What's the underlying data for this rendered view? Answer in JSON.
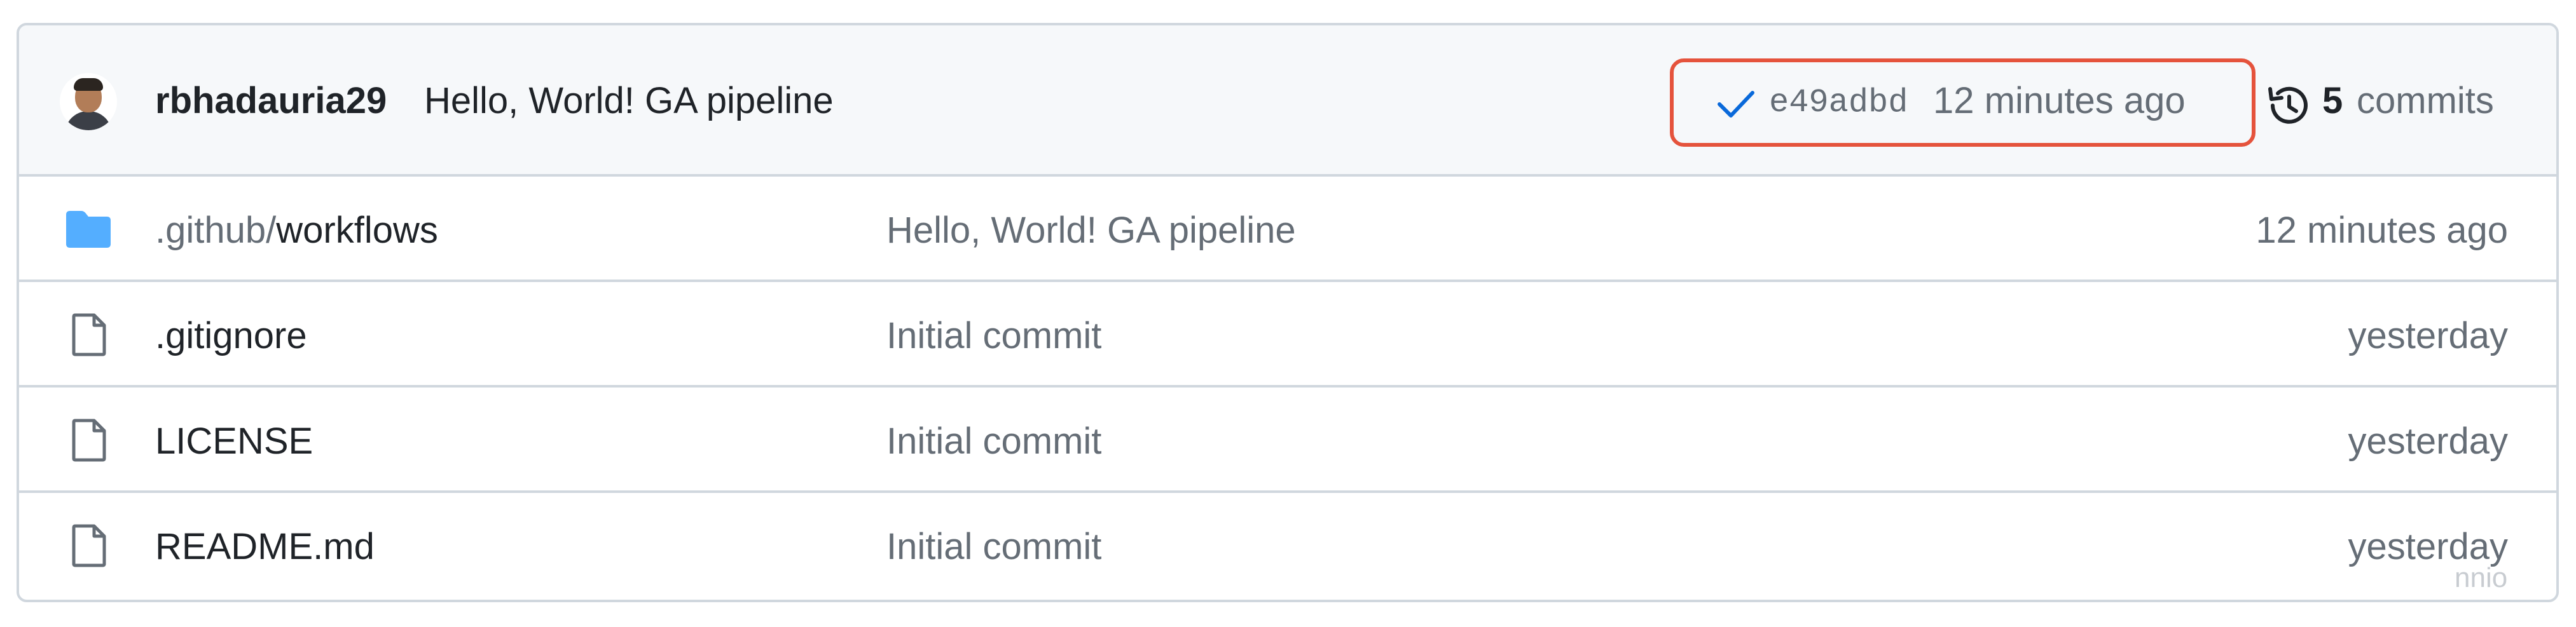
{
  "latest_commit": {
    "author": "rbhadauria29",
    "message": "Hello, World! GA pipeline",
    "status_icon": "check-icon",
    "sha": "e49adbd",
    "time": "12 minutes ago",
    "history_icon": "history-icon",
    "commits_count": "5",
    "commits_label": "commits"
  },
  "files": [
    {
      "icon": "folder-icon",
      "name_prefix": ".github/",
      "name": "workflows",
      "commit": "Hello, World! GA pipeline",
      "age": "12 minutes ago"
    },
    {
      "icon": "file-icon",
      "name": ".gitignore",
      "commit": "Initial commit",
      "age": "yesterday"
    },
    {
      "icon": "file-icon",
      "name": "LICENSE",
      "commit": "Initial commit",
      "age": "yesterday"
    },
    {
      "icon": "file-icon",
      "name": "README.md",
      "commit": "Initial commit",
      "age": "yesterday"
    }
  ],
  "watermark": "nnio",
  "colors": {
    "border": "#d0d7de",
    "header_bg": "#f6f8fa",
    "highlight": "#e5533c",
    "folder": "#54aeff",
    "check": "#0969da",
    "muted": "#656d76"
  }
}
